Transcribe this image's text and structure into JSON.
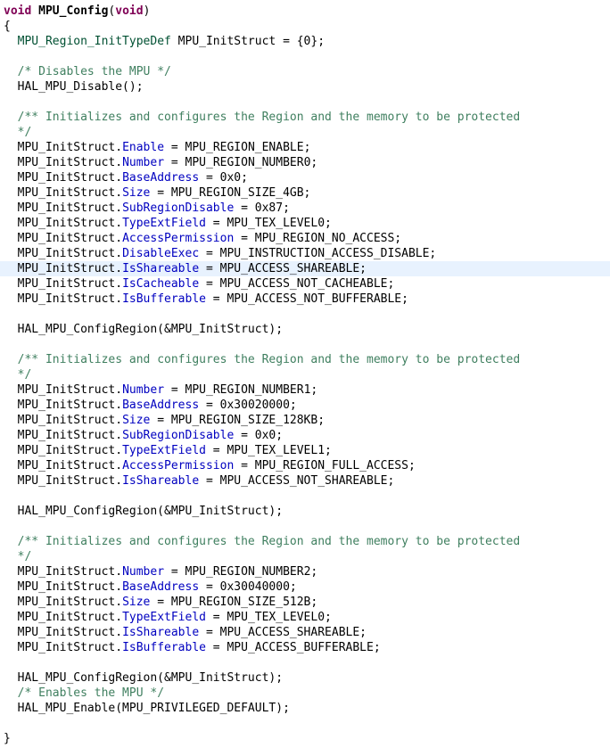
{
  "editor": {
    "highlight_color": "#e8f2fe",
    "colors": {
      "keyword": "#7f0055",
      "type": "#005032",
      "field": "#0000c0",
      "comment": "#3f7f5f",
      "text": "#000000"
    },
    "lines": [
      {
        "tokens": [
          {
            "t": "kw",
            "v": "void"
          },
          {
            "t": "plain",
            "v": " "
          },
          {
            "t": "fn",
            "v": "MPU_Config"
          },
          {
            "t": "plain",
            "v": "("
          },
          {
            "t": "kw",
            "v": "void"
          },
          {
            "t": "plain",
            "v": ")"
          }
        ]
      },
      {
        "tokens": [
          {
            "t": "plain",
            "v": "{"
          }
        ]
      },
      {
        "tokens": [
          {
            "t": "plain",
            "v": "  "
          },
          {
            "t": "type",
            "v": "MPU_Region_InitTypeDef"
          },
          {
            "t": "plain",
            "v": " MPU_InitStruct = {0};"
          }
        ]
      },
      {
        "tokens": []
      },
      {
        "tokens": [
          {
            "t": "plain",
            "v": "  "
          },
          {
            "t": "comment",
            "v": "/* Disables the MPU */"
          }
        ]
      },
      {
        "tokens": [
          {
            "t": "plain",
            "v": "  HAL_MPU_Disable();"
          }
        ]
      },
      {
        "tokens": []
      },
      {
        "tokens": [
          {
            "t": "plain",
            "v": "  "
          },
          {
            "t": "comment",
            "v": "/** Initializes and configures the Region and the memory to be protected"
          }
        ]
      },
      {
        "tokens": [
          {
            "t": "plain",
            "v": "  "
          },
          {
            "t": "comment",
            "v": "*/"
          }
        ]
      },
      {
        "tokens": [
          {
            "t": "plain",
            "v": "  MPU_InitStruct."
          },
          {
            "t": "field",
            "v": "Enable"
          },
          {
            "t": "plain",
            "v": " = MPU_REGION_ENABLE;"
          }
        ]
      },
      {
        "tokens": [
          {
            "t": "plain",
            "v": "  MPU_InitStruct."
          },
          {
            "t": "field",
            "v": "Number"
          },
          {
            "t": "plain",
            "v": " = MPU_REGION_NUMBER0;"
          }
        ]
      },
      {
        "tokens": [
          {
            "t": "plain",
            "v": "  MPU_InitStruct."
          },
          {
            "t": "field",
            "v": "BaseAddress"
          },
          {
            "t": "plain",
            "v": " = 0x0;"
          }
        ]
      },
      {
        "tokens": [
          {
            "t": "plain",
            "v": "  MPU_InitStruct."
          },
          {
            "t": "field",
            "v": "Size"
          },
          {
            "t": "plain",
            "v": " = MPU_REGION_SIZE_4GB;"
          }
        ]
      },
      {
        "tokens": [
          {
            "t": "plain",
            "v": "  MPU_InitStruct."
          },
          {
            "t": "field",
            "v": "SubRegionDisable"
          },
          {
            "t": "plain",
            "v": " = 0x87;"
          }
        ]
      },
      {
        "tokens": [
          {
            "t": "plain",
            "v": "  MPU_InitStruct."
          },
          {
            "t": "field",
            "v": "TypeExtField"
          },
          {
            "t": "plain",
            "v": " = MPU_TEX_LEVEL0;"
          }
        ]
      },
      {
        "tokens": [
          {
            "t": "plain",
            "v": "  MPU_InitStruct."
          },
          {
            "t": "field",
            "v": "AccessPermission"
          },
          {
            "t": "plain",
            "v": " = MPU_REGION_NO_ACCESS;"
          }
        ]
      },
      {
        "tokens": [
          {
            "t": "plain",
            "v": "  MPU_InitStruct."
          },
          {
            "t": "field",
            "v": "DisableExec"
          },
          {
            "t": "plain",
            "v": " = MPU_INSTRUCTION_ACCESS_DISABLE;"
          }
        ]
      },
      {
        "highlight": true,
        "tokens": [
          {
            "t": "plain",
            "v": "  MPU_InitStruct."
          },
          {
            "t": "field",
            "v": "IsShareable"
          },
          {
            "t": "plain",
            "v": " = MPU_ACCESS_SHAREABLE;"
          }
        ]
      },
      {
        "tokens": [
          {
            "t": "plain",
            "v": "  MPU_InitStruct."
          },
          {
            "t": "field",
            "v": "IsCacheable"
          },
          {
            "t": "plain",
            "v": " = MPU_ACCESS_NOT_CACHEABLE;"
          }
        ]
      },
      {
        "tokens": [
          {
            "t": "plain",
            "v": "  MPU_InitStruct."
          },
          {
            "t": "field",
            "v": "IsBufferable"
          },
          {
            "t": "plain",
            "v": " = MPU_ACCESS_NOT_BUFFERABLE;"
          }
        ]
      },
      {
        "tokens": []
      },
      {
        "tokens": [
          {
            "t": "plain",
            "v": "  HAL_MPU_ConfigRegion(&MPU_InitStruct);"
          }
        ]
      },
      {
        "tokens": []
      },
      {
        "tokens": [
          {
            "t": "plain",
            "v": "  "
          },
          {
            "t": "comment",
            "v": "/** Initializes and configures the Region and the memory to be protected"
          }
        ]
      },
      {
        "tokens": [
          {
            "t": "plain",
            "v": "  "
          },
          {
            "t": "comment",
            "v": "*/"
          }
        ]
      },
      {
        "tokens": [
          {
            "t": "plain",
            "v": "  MPU_InitStruct."
          },
          {
            "t": "field",
            "v": "Number"
          },
          {
            "t": "plain",
            "v": " = MPU_REGION_NUMBER1;"
          }
        ]
      },
      {
        "tokens": [
          {
            "t": "plain",
            "v": "  MPU_InitStruct."
          },
          {
            "t": "field",
            "v": "BaseAddress"
          },
          {
            "t": "plain",
            "v": " = 0x30020000;"
          }
        ]
      },
      {
        "tokens": [
          {
            "t": "plain",
            "v": "  MPU_InitStruct."
          },
          {
            "t": "field",
            "v": "Size"
          },
          {
            "t": "plain",
            "v": " = MPU_REGION_SIZE_128KB;"
          }
        ]
      },
      {
        "tokens": [
          {
            "t": "plain",
            "v": "  MPU_InitStruct."
          },
          {
            "t": "field",
            "v": "SubRegionDisable"
          },
          {
            "t": "plain",
            "v": " = 0x0;"
          }
        ]
      },
      {
        "tokens": [
          {
            "t": "plain",
            "v": "  MPU_InitStruct."
          },
          {
            "t": "field",
            "v": "TypeExtField"
          },
          {
            "t": "plain",
            "v": " = MPU_TEX_LEVEL1;"
          }
        ]
      },
      {
        "tokens": [
          {
            "t": "plain",
            "v": "  MPU_InitStruct."
          },
          {
            "t": "field",
            "v": "AccessPermission"
          },
          {
            "t": "plain",
            "v": " = MPU_REGION_FULL_ACCESS;"
          }
        ]
      },
      {
        "tokens": [
          {
            "t": "plain",
            "v": "  MPU_InitStruct."
          },
          {
            "t": "field",
            "v": "IsShareable"
          },
          {
            "t": "plain",
            "v": " = MPU_ACCESS_NOT_SHAREABLE;"
          }
        ]
      },
      {
        "tokens": []
      },
      {
        "tokens": [
          {
            "t": "plain",
            "v": "  HAL_MPU_ConfigRegion(&MPU_InitStruct);"
          }
        ]
      },
      {
        "tokens": []
      },
      {
        "tokens": [
          {
            "t": "plain",
            "v": "  "
          },
          {
            "t": "comment",
            "v": "/** Initializes and configures the Region and the memory to be protected"
          }
        ]
      },
      {
        "tokens": [
          {
            "t": "plain",
            "v": "  "
          },
          {
            "t": "comment",
            "v": "*/"
          }
        ]
      },
      {
        "tokens": [
          {
            "t": "plain",
            "v": "  MPU_InitStruct."
          },
          {
            "t": "field",
            "v": "Number"
          },
          {
            "t": "plain",
            "v": " = MPU_REGION_NUMBER2;"
          }
        ]
      },
      {
        "tokens": [
          {
            "t": "plain",
            "v": "  MPU_InitStruct."
          },
          {
            "t": "field",
            "v": "BaseAddress"
          },
          {
            "t": "plain",
            "v": " = 0x30040000;"
          }
        ]
      },
      {
        "tokens": [
          {
            "t": "plain",
            "v": "  MPU_InitStruct."
          },
          {
            "t": "field",
            "v": "Size"
          },
          {
            "t": "plain",
            "v": " = MPU_REGION_SIZE_512B;"
          }
        ]
      },
      {
        "tokens": [
          {
            "t": "plain",
            "v": "  MPU_InitStruct."
          },
          {
            "t": "field",
            "v": "TypeExtField"
          },
          {
            "t": "plain",
            "v": " = MPU_TEX_LEVEL0;"
          }
        ]
      },
      {
        "tokens": [
          {
            "t": "plain",
            "v": "  MPU_InitStruct."
          },
          {
            "t": "field",
            "v": "IsShareable"
          },
          {
            "t": "plain",
            "v": " = MPU_ACCESS_SHAREABLE;"
          }
        ]
      },
      {
        "tokens": [
          {
            "t": "plain",
            "v": "  MPU_InitStruct."
          },
          {
            "t": "field",
            "v": "IsBufferable"
          },
          {
            "t": "plain",
            "v": " = MPU_ACCESS_BUFFERABLE;"
          }
        ]
      },
      {
        "tokens": []
      },
      {
        "tokens": [
          {
            "t": "plain",
            "v": "  HAL_MPU_ConfigRegion(&MPU_InitStruct);"
          }
        ]
      },
      {
        "tokens": [
          {
            "t": "plain",
            "v": "  "
          },
          {
            "t": "comment",
            "v": "/* Enables the MPU */"
          }
        ]
      },
      {
        "tokens": [
          {
            "t": "plain",
            "v": "  HAL_MPU_Enable(MPU_PRIVILEGED_DEFAULT);"
          }
        ]
      },
      {
        "tokens": []
      },
      {
        "tokens": [
          {
            "t": "plain",
            "v": "}"
          }
        ]
      }
    ]
  }
}
